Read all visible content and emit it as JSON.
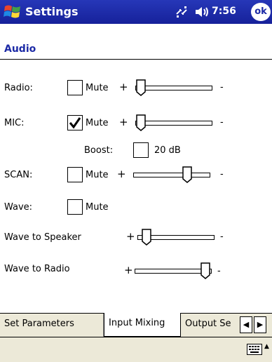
{
  "titlebar": {
    "title": "Settings",
    "time": "7:56",
    "ok_label": "ok",
    "icons": [
      "windows-logo-icon",
      "connectivity-icon",
      "speaker-volume-icon"
    ]
  },
  "page": {
    "heading": "Audio"
  },
  "rows": {
    "radio": {
      "label": "Radio:",
      "mute_label": "Mute",
      "muted": false,
      "level": 0.0
    },
    "mic": {
      "label": "MIC:",
      "mute_label": "Mute",
      "muted": true,
      "level": 0.0
    },
    "boost": {
      "label": "Boost:",
      "value_label": "20 dB",
      "checked": false
    },
    "scan": {
      "label": "SCAN:",
      "mute_label": "Mute",
      "muted": false,
      "level": 0.6
    },
    "wave": {
      "label": "Wave:",
      "mute_label": "Mute",
      "muted": false
    },
    "wave_to_speaker": {
      "label": "Wave to Speaker",
      "level": 0.05
    },
    "wave_to_radio": {
      "label": "Wave to Radio",
      "level": 0.95
    }
  },
  "symbols": {
    "plus": "+",
    "minus": "-"
  },
  "tabs": [
    {
      "label": "Set Parameters",
      "active": false
    },
    {
      "label": "Input Mixing",
      "active": true
    },
    {
      "label": "Output Se",
      "active": false
    }
  ],
  "tab_nav": {
    "left": "◀",
    "right": "▶"
  },
  "bottombar": {
    "icons": [
      "keyboard-icon",
      "sip-up-arrow-icon"
    ],
    "arrow": "▲"
  }
}
